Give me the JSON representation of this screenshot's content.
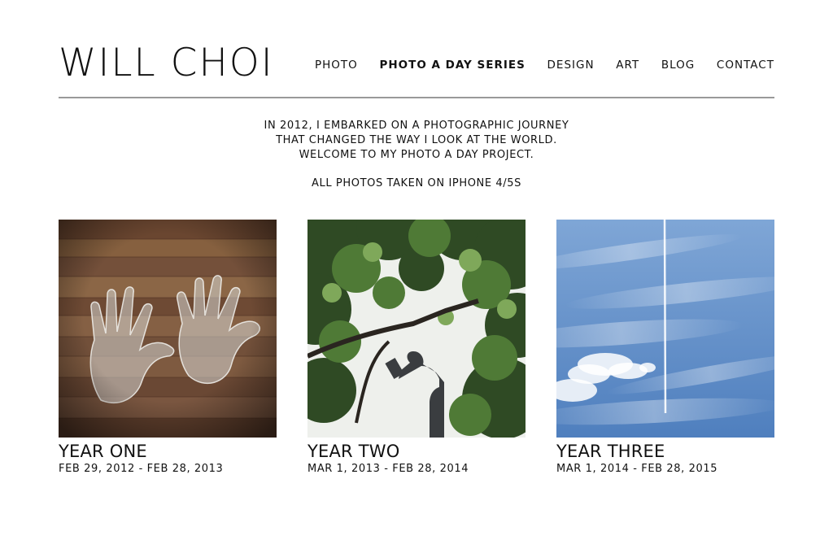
{
  "site": {
    "title": "WILL CHOI"
  },
  "nav": {
    "items": [
      {
        "label": "PHOTO",
        "active": false
      },
      {
        "label": "PHOTO A DAY SERIES",
        "active": true
      },
      {
        "label": "DESIGN",
        "active": false
      },
      {
        "label": "ART",
        "active": false
      },
      {
        "label": "BLOG",
        "active": false
      },
      {
        "label": "CONTACT",
        "active": false
      }
    ]
  },
  "intro": {
    "lines": [
      "IN 2012, I EMBARKED ON A PHOTOGRAPHIC JOURNEY",
      "THAT CHANGED THE WAY I LOOK AT THE WORLD.",
      "WELCOME TO MY PHOTO A DAY PROJECT."
    ],
    "note": "ALL PHOTOS TAKEN ON IPHONE 4/5S"
  },
  "gallery": {
    "items": [
      {
        "title": "YEAR ONE",
        "dates": "FEB 29, 2012 - FEB 28, 2013",
        "image": "plastic-gloves-on-wood-photo"
      },
      {
        "title": "YEAR TWO",
        "dates": "MAR 1, 2013 - FEB 28, 2014",
        "image": "statue-under-trees-photo"
      },
      {
        "title": "YEAR THREE",
        "dates": "MAR 1, 2014 - FEB 28, 2015",
        "image": "sky-contrail-photo"
      }
    ]
  },
  "colors": {
    "text": "#111111",
    "rule": "#999999",
    "background": "#ffffff"
  }
}
